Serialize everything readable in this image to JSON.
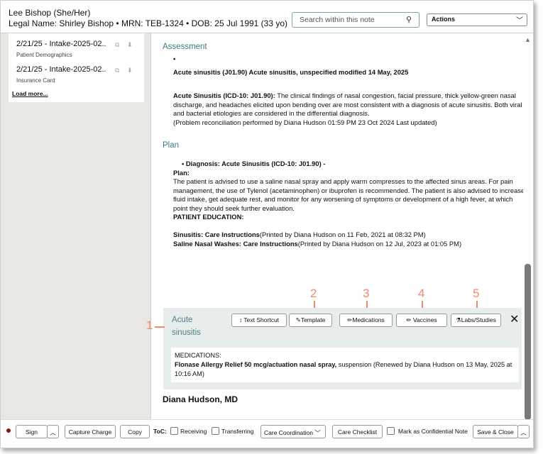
{
  "header": {
    "patient_name": "Lee Bishop",
    "pronouns": "(She/Her)",
    "legal_line": "Legal Name: Shirley Bishop • MRN: TEB-1324 • DOB: 25 Jul 1991 (33 yo)",
    "search_placeholder": "Search within this note",
    "actions_label": "Actions"
  },
  "sidebar": {
    "documents": [
      {
        "title": "2/21/25 - Intake-2025-02..",
        "subtitle": "Patient Demographics"
      },
      {
        "title": "2/21/25 - Intake-2025-02..",
        "subtitle": "Insurance Card"
      }
    ],
    "load_more": "Load more..."
  },
  "note": {
    "assessment_heading": "Assessment",
    "assessment_bullet": "•",
    "assessment_dx": "Acute sinusitis (J01.90) Acute sinusitis, unspecified modified 14 May, 2025",
    "assessment_label": "Acute Sinusitis (ICD-10: J01.90):",
    "assessment_text": " The clinical findings of nasal congestion, facial pressure, thick yellow-green nasal discharge, and headaches elicited upon bending over are most consistent with a diagnosis of acute sinusitis. Both viral and bacterial etiologies are considered in the differential diagnosis.",
    "assessment_reconcile": "(Problem reconciliation performed by Diana Hudson 01:59 PM 23 Oct 2024 Last updated)",
    "plan_heading": "Plan",
    "plan_dx": "Diagnosis: Acute Sinusitis (ICD-10: J01.90) -",
    "plan_label": "Plan:",
    "plan_text": "The patient is advised to use a saline nasal spray and apply warm compresses to the affected sinus areas. For pain management, the use of Tylenol (acetaminophen) or ibuprofen is recommended. The patient is also advised to increase fluid intake, get adequate rest, and monitor for any worsening of symptoms or development of a high fever, at which point they should seek further evaluation.",
    "patient_education": "PATIENT EDUCATION:",
    "edu1_label": "Sinusitis: Care Instructions",
    "edu1_text": "(Printed by Diana Hudson on 11 Feb, 2021 at 08:32 PM)",
    "edu2_label": "Saline Nasal Washes: Care Instructions",
    "edu2_text": "(Printed by Diana Hudson on 12 Jul, 2023 at 01:05 PM)",
    "signature": "Diana Hudson, MD"
  },
  "panel": {
    "title": "Acute sinusitis",
    "buttons": [
      "Text Shortcut",
      "Template",
      "Medications",
      "Vaccines",
      "Labs/Studies"
    ],
    "meds_heading": "MEDICATIONS:",
    "med_name": "Flonase Allergy Relief 50 mcg/actuation nasal spray,",
    "med_detail": " suspension (Renewed by Diana Hudson on 13 May, 2025 at 10:16 AM)"
  },
  "callouts": [
    "1",
    "2",
    "3",
    "4",
    "5"
  ],
  "footer": {
    "sign": "Sign",
    "capture_charge": "Capture Charge",
    "copy": "Copy",
    "toc": "ToC:",
    "receiving": "Receiving",
    "transferring": "Transferring",
    "care_coordination": "Care Coordination",
    "care_checklist": "Care Checklist",
    "confidential": "Mark as Confidential Note",
    "save_close": "Save & Close"
  },
  "colors": {
    "accent": "#3d7a80",
    "callout": "#f08a6a",
    "status_dot": "#8b1010"
  }
}
